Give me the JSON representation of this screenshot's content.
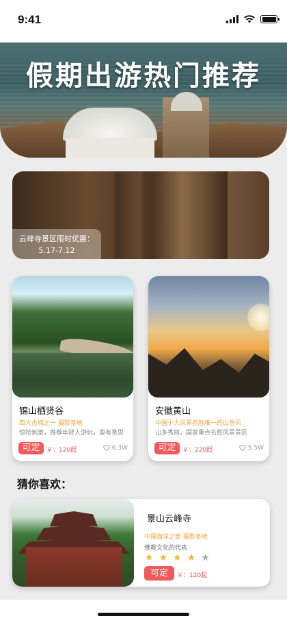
{
  "status_bar": {
    "time": "9:41"
  },
  "hero": {
    "title": "假期出游热门推荐"
  },
  "banner": {
    "promo_line1": "云峰寺景区限时优惠：",
    "promo_line2": "5.17-7.12"
  },
  "cards": [
    {
      "title": "锦山栖贤谷",
      "subtitle": "四大古城之一 摄影圣地",
      "desc": "惊险刺激，推荐年轻人游玩，蛮有意思",
      "book_label": "可定",
      "price": "￥：120起",
      "likes": "6.3W"
    },
    {
      "title": "安徽黄山",
      "subtitle": "中国十大风景名胜唯一的山岳风",
      "desc": "山多秀丽，国家重点名胜风景景区",
      "book_label": "可定",
      "price": "￥：220起",
      "likes": "5.5W"
    }
  ],
  "guess": {
    "section_title": "猜你喜欢：",
    "item": {
      "title": "景山云峰寺",
      "subtitle": "中国海洋之窗 摄影圣地",
      "desc": "佛教文化的代表",
      "rating": 4,
      "rating_max": 5,
      "book_label": "可定",
      "price": "￥：120起"
    }
  },
  "icons": {
    "signal": "signal-icon",
    "wifi": "wifi-icon",
    "battery": "battery-icon",
    "heart": "heart-icon",
    "star": "star-icon"
  },
  "colors": {
    "accent": "#f05a5a",
    "highlight": "#f2a33a",
    "star": "#f5b82e"
  }
}
